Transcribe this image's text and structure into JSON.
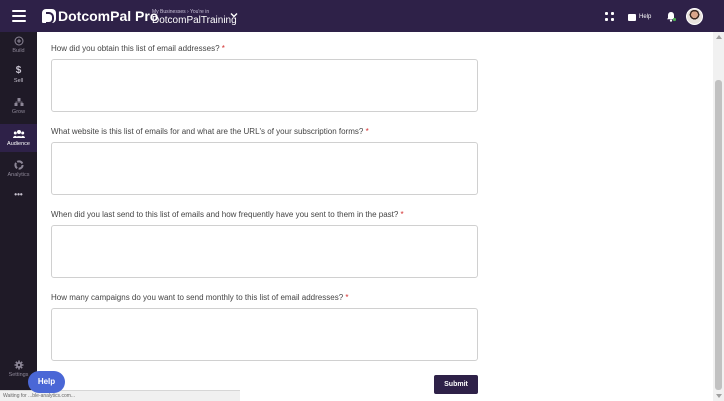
{
  "topbar": {
    "brand": "DotcomPal Pro",
    "business_small": "My Businesses › You're in",
    "business_name": "DotcomPalTraining",
    "help_label": "Help"
  },
  "sidebar": {
    "items": [
      {
        "label": "Build",
        "icon": "plus-circle-icon"
      },
      {
        "label": "Sell",
        "icon": "dollar-icon"
      },
      {
        "label": "Grow",
        "icon": "hierarchy-icon"
      },
      {
        "label": "Audience",
        "icon": "group-icon"
      },
      {
        "label": "Analytics",
        "icon": "donut-chart-icon"
      },
      {
        "label": "•••",
        "icon": "more-icon"
      }
    ],
    "settings_label": "Settings"
  },
  "form": {
    "questions": [
      {
        "label": "How did you obtain this list of email addresses?",
        "required_mark": "*",
        "value": ""
      },
      {
        "label": "What website is this list of emails for and what are the URL's of your subscription forms?",
        "required_mark": "*",
        "value": ""
      },
      {
        "label": "When did you last send to this list of emails and how frequently have you sent to them in the past?",
        "required_mark": "*",
        "value": ""
      },
      {
        "label": "How many campaigns do you want to send monthly to this list of email addresses?",
        "required_mark": "*",
        "value": ""
      }
    ],
    "submit_label": "Submit"
  },
  "help_button_label": "Help",
  "status_text": "Waiting for ...ble-analytics.com...",
  "colors": {
    "topbar": "#2e2148",
    "sidebar": "#1f1a27",
    "primary_button": "#2e2148",
    "help_button": "#4a67d6",
    "required": "#d32f2f"
  }
}
